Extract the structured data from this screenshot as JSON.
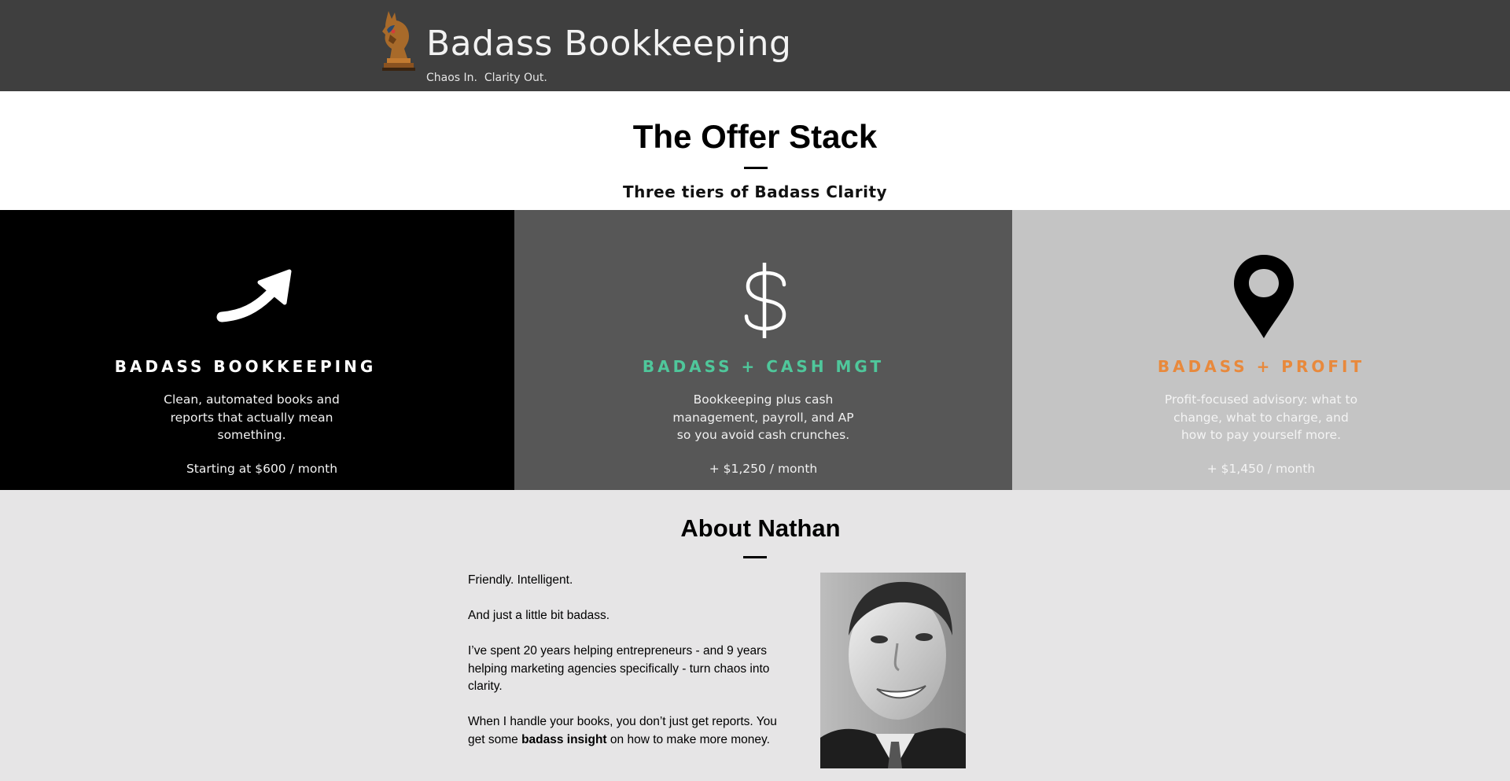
{
  "header": {
    "title": "Badass Bookkeeping",
    "tagline": "Chaos In.  Clarity Out."
  },
  "offer": {
    "title": "The Offer Stack",
    "subtitle": "Three tiers of Badass Clarity",
    "tiers": [
      {
        "icon": "arrow-up-right-icon",
        "name": "BADASS BOOKKEEPING",
        "description": "Clean, automated books and reports that actually mean something.",
        "price": "Starting at $600 / month",
        "bg_color": "#000000",
        "name_color": "#ffffff"
      },
      {
        "icon": "dollar-icon",
        "name": "BADASS + CASH MGT",
        "description": "Bookkeeping plus cash management, payroll, and AP so you avoid cash crunches.",
        "price": "+ $1,250 / month",
        "bg_color": "#575757",
        "name_color": "#4fc79b"
      },
      {
        "icon": "map-pin-icon",
        "name": "BADASS + PROFIT",
        "description": "Profit-focused advisory: what to change, what to charge, and how to pay yourself more.",
        "price": "+ $1,450 / month",
        "bg_color": "#c4c4c4",
        "name_color": "#e8893c"
      }
    ]
  },
  "about": {
    "title": "About Nathan",
    "p1": "Friendly.  Intelligent.",
    "p2": "And just a little bit badass.",
    "p3": "I’ve spent 20 years helping entrepreneurs - and 9 years helping marketing agencies specifically - turn chaos into clarity.",
    "p4_a": "When I handle your books, you don’t just get reports. You get some ",
    "p4_bold": "badass insight",
    "p4_b": " on how to make more money."
  }
}
